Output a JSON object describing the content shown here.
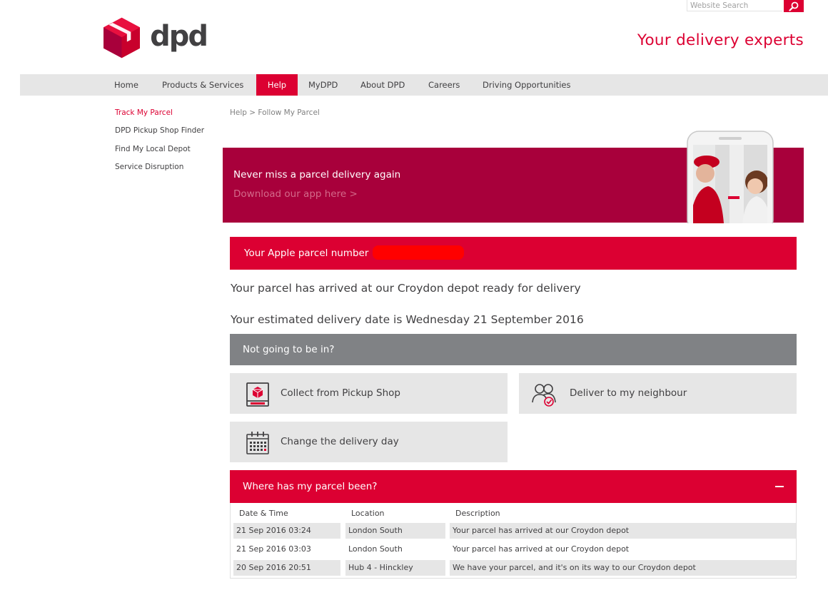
{
  "search": {
    "placeholder": "Website Search"
  },
  "brand": {
    "logo_text": "dpd",
    "tagline": "Your delivery experts",
    "red": "#dc0032",
    "banner_red": "#a8003b",
    "grey": "#808285"
  },
  "nav": {
    "items": [
      {
        "label": "Home"
      },
      {
        "label": "Products & Services"
      },
      {
        "label": "Help"
      },
      {
        "label": "MyDPD"
      },
      {
        "label": "About DPD"
      },
      {
        "label": "Careers"
      },
      {
        "label": "Driving Opportunities"
      }
    ]
  },
  "sidebar": {
    "items": [
      {
        "label": "Track My Parcel"
      },
      {
        "label": "DPD Pickup Shop Finder"
      },
      {
        "label": "Find My Local Depot"
      },
      {
        "label": "Service Disruption"
      }
    ]
  },
  "breadcrumb": {
    "text": "Help  >  Follow My Parcel"
  },
  "banner": {
    "title": "Never miss a parcel delivery again",
    "link": "Download our app here >"
  },
  "parcel": {
    "label": "Your Apple parcel number",
    "status": "Your parcel has arrived at our Croydon depot ready for delivery",
    "estimate": "Your estimated delivery date is Wednesday 21 September 2016"
  },
  "not_in": {
    "title": "Not going to be in?",
    "options": [
      {
        "label": "Collect from Pickup Shop",
        "icon": "pickup-shop-icon"
      },
      {
        "label": "Deliver to my neighbour",
        "icon": "neighbour-icon"
      },
      {
        "label": "Change the delivery day",
        "icon": "calendar-icon"
      }
    ]
  },
  "history": {
    "title": "Where has my parcel been?",
    "columns": [
      "Date & Time",
      "Location",
      "Description"
    ],
    "rows": [
      [
        "21 Sep 2016 03:24",
        "London South",
        "Your parcel has arrived at our Croydon depot"
      ],
      [
        "21 Sep 2016 03:03",
        "London South",
        "Your parcel has arrived at our Croydon depot"
      ],
      [
        "20 Sep 2016 20:51",
        "Hub 4 - Hinckley",
        "We have your parcel, and it's on its way to our Croydon depot"
      ]
    ]
  }
}
